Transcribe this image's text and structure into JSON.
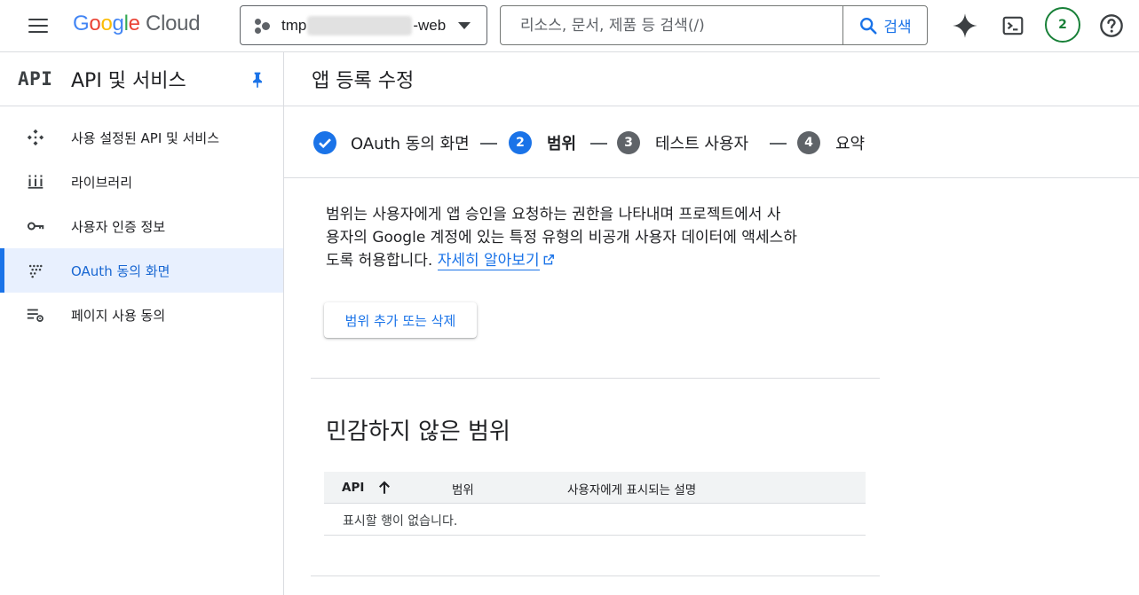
{
  "topbar": {
    "logo_google": [
      "G",
      "o",
      "o",
      "g",
      "l",
      "e"
    ],
    "logo_google_colors": [
      "#4285f4",
      "#ea4335",
      "#fbbc04",
      "#4285f4",
      "#34a853",
      "#ea4335"
    ],
    "logo_cloud": "Cloud",
    "project_prefix": "tmp",
    "project_suffix": "-web",
    "search_placeholder": "리소스, 문서, 제품 등 검색(/)",
    "search_button": "검색",
    "notification_count": "2"
  },
  "sidebar": {
    "brand": "API",
    "title": "API 및 서비스",
    "items": [
      {
        "label": "사용 설정된 API 및 서비스",
        "icon": "api-diamond-icon",
        "active": false
      },
      {
        "label": "라이브러리",
        "icon": "library-icon",
        "active": false
      },
      {
        "label": "사용자 인증 정보",
        "icon": "key-icon",
        "active": false
      },
      {
        "label": "OAuth 동의 화면",
        "icon": "oauth-dots-icon",
        "active": true
      },
      {
        "label": "페이지 사용 동의",
        "icon": "list-settings-icon",
        "active": false
      }
    ]
  },
  "main": {
    "title": "앱 등록 수정",
    "steps": [
      {
        "number": "",
        "label": "OAuth 동의 화면",
        "state": "complete"
      },
      {
        "number": "2",
        "label": "범위",
        "state": "current"
      },
      {
        "number": "3",
        "label": "테스트 사용자",
        "state": "pending"
      },
      {
        "number": "4",
        "label": "요약",
        "state": "pending"
      }
    ],
    "description_lines": [
      "범위는 사용자에게 앱 승인을 요청하는 권한을 나타내며 프로젝트에서 사",
      "용자의 Google 계정에 있는 특정 유형의 비공개 사용자 데이터에 액세스하",
      "도록 허용합니다."
    ],
    "learn_more": "자세히 알아보기",
    "add_scope_button": "범위 추가 또는 삭제",
    "section_title": "민감하지 않은 범위",
    "table": {
      "columns": [
        "API",
        "범위",
        "사용자에게 표시되는 설명"
      ],
      "sort_column": "API",
      "sort_direction": "ascending",
      "empty_message": "표시할 행이 없습니다."
    }
  },
  "colors": {
    "accent": "#1a73e8",
    "active_bg": "#e8f0fe",
    "badge": "#188038"
  }
}
